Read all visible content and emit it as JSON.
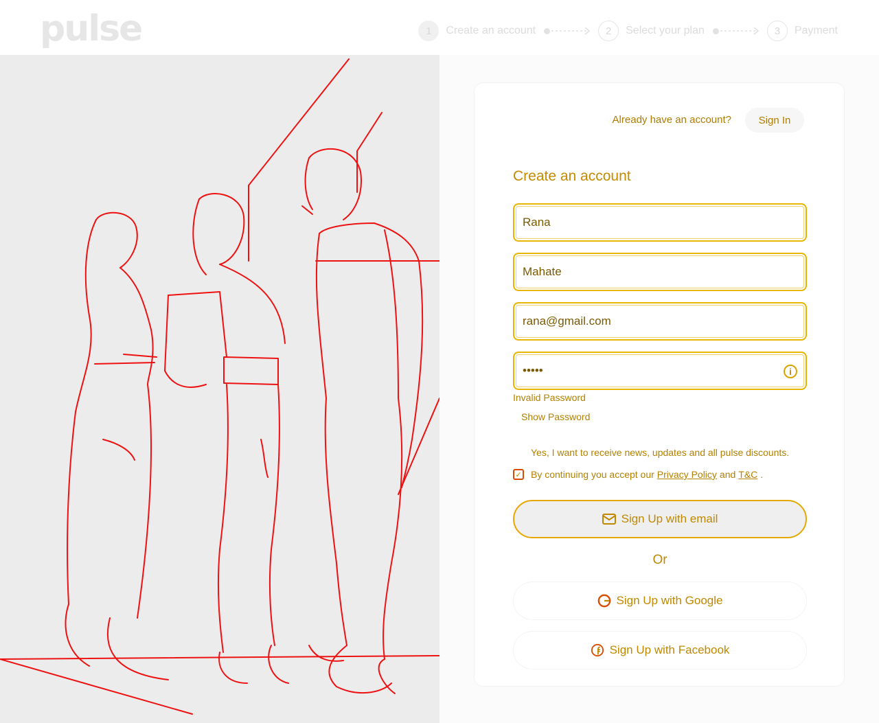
{
  "header": {
    "logo": "pulse",
    "steps": [
      {
        "num": "1",
        "label": "Create an account"
      },
      {
        "num": "2",
        "label": "Select your plan"
      },
      {
        "num": "3",
        "label": "Payment"
      }
    ]
  },
  "signin": {
    "prompt": "Already have an account?",
    "button": "Sign In"
  },
  "form": {
    "title": "Create an account",
    "first_name": "Rana",
    "last_name": "Mahate",
    "email": "rana@gmail.com",
    "password": "•••••",
    "error": "Invalid Password",
    "show_password": "Show Password",
    "newsletter": "Yes, I want to receive news, updates and all pulse discounts.",
    "terms_prefix": "By continuing you accept our",
    "privacy_link": "Privacy Policy",
    "terms_and": "and",
    "tc_link": "T&C",
    "terms_suffix": "."
  },
  "buttons": {
    "email": "Sign Up with email",
    "or": "Or",
    "google": "Sign Up with Google",
    "facebook": "Sign Up with Facebook"
  },
  "colors": {
    "accent": "#e6a800",
    "accent_text": "#c08800",
    "error_red": "#d94a00"
  }
}
